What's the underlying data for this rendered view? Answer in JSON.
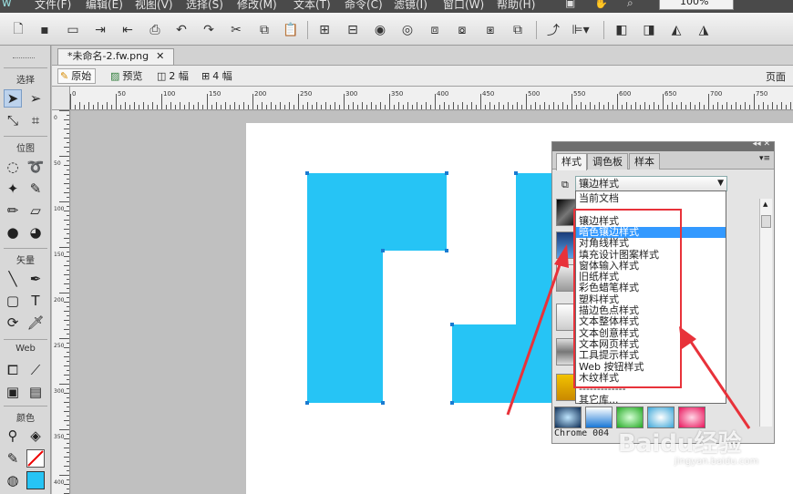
{
  "menubar": {
    "app_logo": "w",
    "items": [
      "文件(F)",
      "编辑(E)",
      "视图(V)",
      "选择(S)",
      "修改(M)",
      "文本(T)",
      "命令(C)",
      "滤镜(I)",
      "窗口(W)",
      "帮助(H)"
    ],
    "zoom_value": "100%"
  },
  "document": {
    "tab_title": "*未命名-2.fw.png",
    "tab_close": "✕"
  },
  "viewbar": {
    "original": "原始",
    "preview": "预览",
    "two_up": "2 幅",
    "four_up": "4 幅",
    "page": "页面"
  },
  "tools": {
    "select": "选择",
    "bitmap": "位图",
    "vector": "矢量",
    "web": "Web",
    "colors": "颜色"
  },
  "rulers": {
    "h_ticks": [
      "0",
      "50",
      "100",
      "150",
      "200",
      "250",
      "300",
      "350",
      "400",
      "450",
      "500",
      "550",
      "600",
      "650",
      "700",
      "750"
    ],
    "v_ticks": [
      "0",
      "50",
      "100",
      "150",
      "200",
      "250",
      "300",
      "350",
      "400"
    ]
  },
  "panel": {
    "tabs": [
      "样式",
      "调色板",
      "样本"
    ],
    "selected_library": "镶边样式",
    "status_text": "Chrome 004",
    "options_icon": "▾≡"
  },
  "dropdown": {
    "options": [
      "当前文档",
      "",
      "镶边样式",
      "暗色镶边样式",
      "对角线样式",
      "填充设计图案样式",
      "窗体输入样式",
      "旧纸样式",
      "彩色蜡笔样式",
      "塑料样式",
      "描边色点样式",
      "文本整体样式",
      "文本创意样式",
      "文本网页样式",
      "工具提示样式",
      "Web 按钮样式",
      "木纹样式",
      "-------------",
      "其它库..."
    ],
    "highlighted_index": 3
  },
  "watermark": {
    "brand": "Baidu经验",
    "url": "jingyan.baidu.com"
  },
  "colors": {
    "shape_fill": "#26c4f5",
    "highlight": "#e8323a",
    "dropdown_selection": "#3399ff"
  }
}
